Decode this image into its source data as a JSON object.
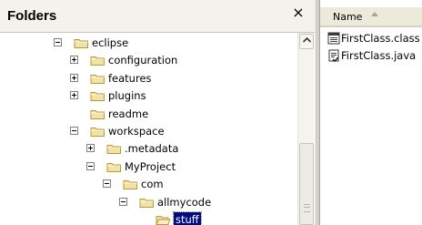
{
  "folders_pane": {
    "title": "Folders",
    "close_glyph": "×"
  },
  "tree": [
    {
      "label": "eclipse",
      "depth": 0,
      "expander": "minus",
      "selected": false,
      "icon": "folder-icon"
    },
    {
      "label": "configuration",
      "depth": 1,
      "expander": "plus",
      "selected": false,
      "icon": "folder-icon"
    },
    {
      "label": "features",
      "depth": 1,
      "expander": "plus",
      "selected": false,
      "icon": "folder-icon"
    },
    {
      "label": "plugins",
      "depth": 1,
      "expander": "plus",
      "selected": false,
      "icon": "folder-icon"
    },
    {
      "label": "readme",
      "depth": 1,
      "expander": "none",
      "selected": false,
      "icon": "folder-icon"
    },
    {
      "label": "workspace",
      "depth": 1,
      "expander": "minus",
      "selected": false,
      "icon": "folder-icon"
    },
    {
      "label": ".metadata",
      "depth": 2,
      "expander": "plus",
      "selected": false,
      "icon": "folder-icon"
    },
    {
      "label": "MyProject",
      "depth": 2,
      "expander": "minus",
      "selected": false,
      "icon": "folder-icon"
    },
    {
      "label": "com",
      "depth": 3,
      "expander": "minus",
      "selected": false,
      "icon": "folder-icon"
    },
    {
      "label": "allmycode",
      "depth": 4,
      "expander": "minus",
      "selected": false,
      "icon": "folder-icon"
    },
    {
      "label": "stuff",
      "depth": 5,
      "expander": "none",
      "selected": true,
      "icon": "open-folder-icon"
    }
  ],
  "file_list": {
    "column_header": "Name",
    "sort_direction": "ascending",
    "files": [
      {
        "name": "FirstClass.class",
        "icon": "class-file-icon"
      },
      {
        "name": "FirstClass.java",
        "icon": "java-file-icon"
      }
    ]
  },
  "colors": {
    "selection": "#000a84",
    "header_bg": "#f3f2ec",
    "folder_fill": "#f1e3a6",
    "folder_stroke": "#b59a3a"
  }
}
